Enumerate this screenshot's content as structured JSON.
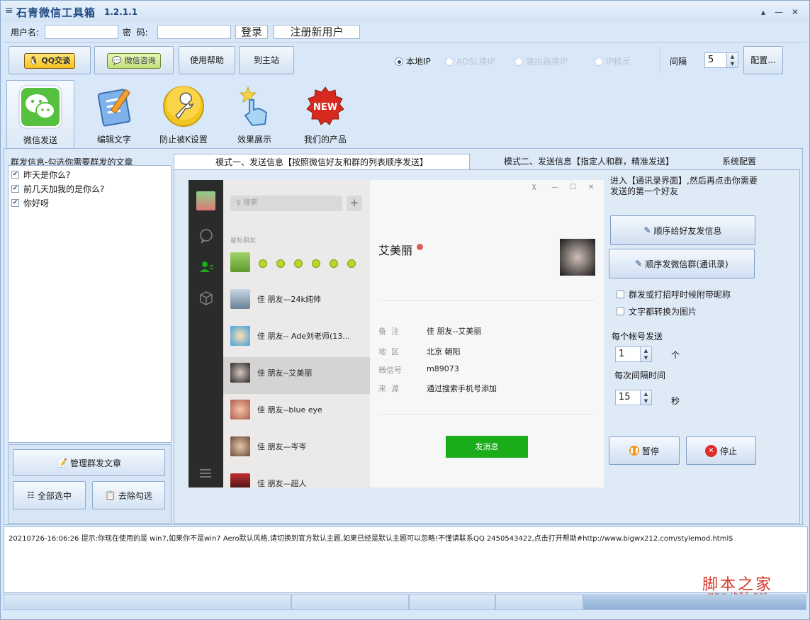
{
  "window": {
    "menu_glyph": "≡",
    "title": "石青微信工具箱",
    "version": "1.2.1.1",
    "controls": {
      "collapse": "▴",
      "minimize": "—",
      "close": "✕"
    }
  },
  "login": {
    "username_label": "用户名:",
    "username_value": "",
    "password_label": "密  码:",
    "password_value": "",
    "login_button": "登录",
    "register_button": "注册新用户"
  },
  "toolbar": {
    "qq_button": "QQ交谈",
    "wechat_button": "微信咨询",
    "help_button": "使用帮助",
    "home_button": "到主站",
    "ip_options": [
      {
        "label": "本地IP",
        "selected": true,
        "enabled": true
      },
      {
        "label": "ADSL换IP",
        "selected": false,
        "enabled": false
      },
      {
        "label": "路由器换IP",
        "selected": false,
        "enabled": false
      },
      {
        "label": "IP精灵",
        "selected": false,
        "enabled": false
      }
    ],
    "interval_label": "间隔",
    "interval_value": "5",
    "config_button": "配置..."
  },
  "big_tabs": [
    {
      "label": "微信发送",
      "icon": "wechat-icon",
      "active": true
    },
    {
      "label": "编辑文字",
      "icon": "edit-text-icon",
      "active": false
    },
    {
      "label": "防止被K设置",
      "icon": "wrench-icon",
      "active": false
    },
    {
      "label": "效果展示",
      "icon": "hand-pointer-icon",
      "active": false
    },
    {
      "label": "我们的产品",
      "icon": "new-badge-icon",
      "active": false
    }
  ],
  "articles": {
    "header": "群发信息-勾选你需要群发的文章",
    "items": [
      {
        "text": "昨天是你么?",
        "checked": true
      },
      {
        "text": "前几天加我的是你么?",
        "checked": true
      },
      {
        "text": "你好呀",
        "checked": true
      }
    ],
    "manage_button": "管理群发文章",
    "select_all_button": "全部选中",
    "uncheck_button": "去除勾选"
  },
  "mode_tabs": [
    {
      "label": "模式一、发送信息【按照微信好友和群的列表顺序发送】",
      "active": true
    },
    {
      "label": "模式二、发送信息【指定人和群，精准发送】",
      "active": false
    },
    {
      "label": "系统配置",
      "active": false
    }
  ],
  "wechat_preview": {
    "search_placeholder": "搜索",
    "plus": "+",
    "group_label": "星标朋友",
    "contacts": [
      {
        "name": "",
        "dots": 6
      },
      {
        "name": "佳 朋友—24k纯帅"
      },
      {
        "name": "佳 朋友-- Ade刘老师(13..."
      },
      {
        "name": "佳 朋友--艾美丽",
        "selected": true
      },
      {
        "name": "佳 朋友--blue eye"
      },
      {
        "name": "佳 朋友—岑岑"
      },
      {
        "name": "佳 朋友—超人"
      }
    ],
    "window_controls": [
      "⊼",
      "—",
      "☐",
      "✕"
    ],
    "profile_name": "艾美丽",
    "fields": [
      {
        "key": "备  注",
        "value": "佳 朋友--艾美丽"
      },
      {
        "key": "地  区",
        "value": "北京 朝阳"
      },
      {
        "key": "微信号",
        "value": "m89073"
      },
      {
        "key": "来  源",
        "value": "通过搜索手机号添加"
      }
    ],
    "send_button": "发消息"
  },
  "side_controls": {
    "instruction": "进入【通讯录界面】,然后再点击你需要发送的第一个好友",
    "send_friends_button": "顺序给好友发信息",
    "send_groups_button": "顺序发微信群(通讯录)",
    "option_nickname": "群发或打招呼时候附带昵称",
    "option_image": "文字都转换为图片",
    "per_account_label": "每个帐号发送",
    "per_account_value": "1",
    "per_account_unit": "个",
    "interval_label": "每次间隔时间",
    "interval_value": "15",
    "interval_unit": "秒",
    "pause_button": "暂停",
    "stop_button": "停止"
  },
  "log": {
    "line": "20210726-16:06:26  提示:你现在使用的是 win7,如果你不是win7 Aero默认风格,请切换到官方默认主题,如果已经是默认主题可以忽略!不懂请联系QQ 2450543422,点击打开帮助#http://www.bigwx212.com/stylemod.html$"
  },
  "watermark": {
    "text": "脚本之家",
    "url": "www.jb51.net"
  },
  "colors": {
    "wechat_green": "#1aad19",
    "accent_blue": "#2a4c7a",
    "stop_red": "#e02b2b",
    "pause_orange": "#f29a1f"
  }
}
